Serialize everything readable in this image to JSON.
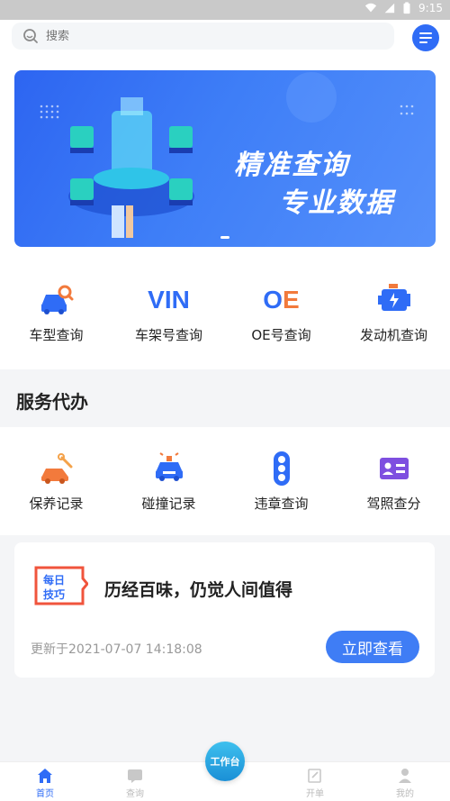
{
  "status_bar": {
    "time": "9:15"
  },
  "search": {
    "placeholder": "搜索",
    "icon": "search-icon"
  },
  "menu": {
    "icon": "menu-icon"
  },
  "banner": {
    "slogan_1": "精准查询",
    "slogan_2": "专业数据"
  },
  "query_grid": [
    {
      "label": "车型查询",
      "icon": "car-search-icon"
    },
    {
      "label": "车架号查询",
      "icon": "vin-icon",
      "text": "VIN"
    },
    {
      "label": "OE号查询",
      "icon": "oe-icon",
      "text": "OE"
    },
    {
      "label": "发动机查询",
      "icon": "engine-icon"
    }
  ],
  "services": {
    "title": "服务代办",
    "items": [
      {
        "label": "保养记录",
        "icon": "maintenance-icon"
      },
      {
        "label": "碰撞记录",
        "icon": "collision-icon"
      },
      {
        "label": "违章查询",
        "icon": "traffic-light-icon"
      },
      {
        "label": "驾照查分",
        "icon": "license-icon"
      }
    ]
  },
  "daily_tip": {
    "badge_line1": "每日",
    "badge_line2": "技巧",
    "title": "历经百味，仍觉人间值得",
    "updated": "更新于2021-07-07 14:18:08",
    "button": "立即查看"
  },
  "tabbar": {
    "center": "工作台",
    "tabs": [
      {
        "label": "首页",
        "icon": "home-icon",
        "active": true
      },
      {
        "label": "查询",
        "icon": "query-icon"
      },
      {
        "label": "",
        "icon": ""
      },
      {
        "label": "开单",
        "icon": "order-icon"
      },
      {
        "label": "我的",
        "icon": "profile-icon"
      }
    ]
  },
  "colors": {
    "primary": "#2f6cf6",
    "accent_orange": "#f27a3c",
    "bg": "#f4f5f7"
  }
}
